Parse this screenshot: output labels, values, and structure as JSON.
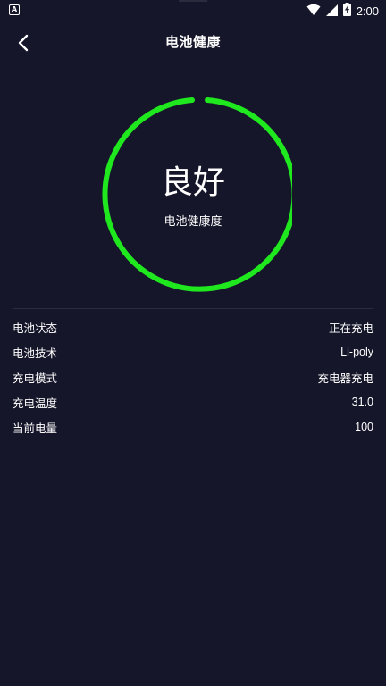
{
  "status_bar": {
    "left_icon": "A",
    "time": "2:00",
    "icons": [
      "wifi-icon",
      "signal-icon",
      "battery-charging-icon"
    ]
  },
  "header": {
    "title": "电池健康",
    "back_icon": "chevron-left-icon"
  },
  "health": {
    "value": "良好",
    "label": "电池健康度",
    "ring_color": "#1fe81f"
  },
  "info": [
    {
      "label": "电池状态",
      "value": "正在充电"
    },
    {
      "label": "电池技术",
      "value": "Li-poly"
    },
    {
      "label": "充电模式",
      "value": "充电器充电"
    },
    {
      "label": "充电温度",
      "value": "31.0"
    },
    {
      "label": "当前电量",
      "value": "100"
    }
  ],
  "colors": {
    "background": "#15162a",
    "accent": "#1fe81f",
    "text": "#ffffff"
  }
}
